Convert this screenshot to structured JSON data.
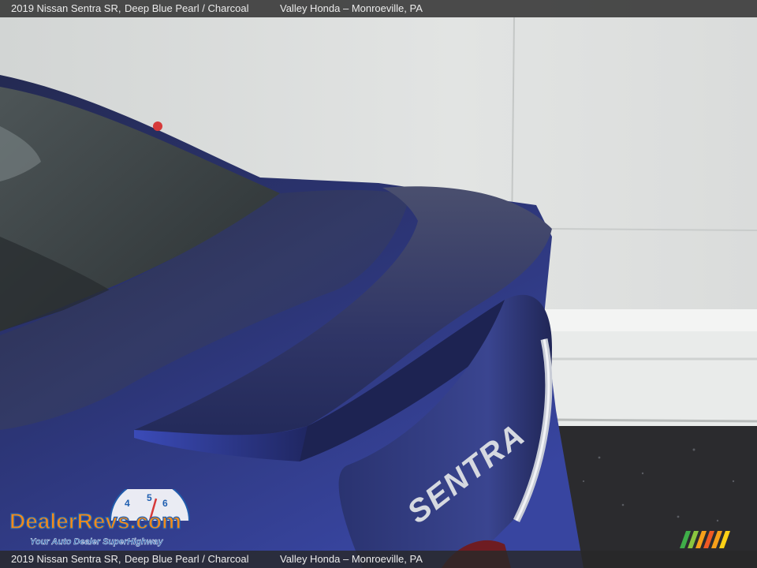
{
  "caption": {
    "model": "2019 Nissan Sentra SR,",
    "color": "Deep Blue Pearl / Charcoal",
    "dealer": "Valley Honda – Monroeville, PA"
  },
  "photo": {
    "badge_text": "SENTRA"
  },
  "watermark": {
    "brand": "DealerRevs.com",
    "tagline": "Your Auto Dealer SuperHighway",
    "dial_numbers": [
      "4",
      "5",
      "6"
    ]
  },
  "colors": {
    "car_body": "#2a3474",
    "wall": "#dcdedd",
    "asphalt": "#2b2b2e",
    "logo_orange": "#f08a1c",
    "logo_blue": "#1f5fb0"
  }
}
